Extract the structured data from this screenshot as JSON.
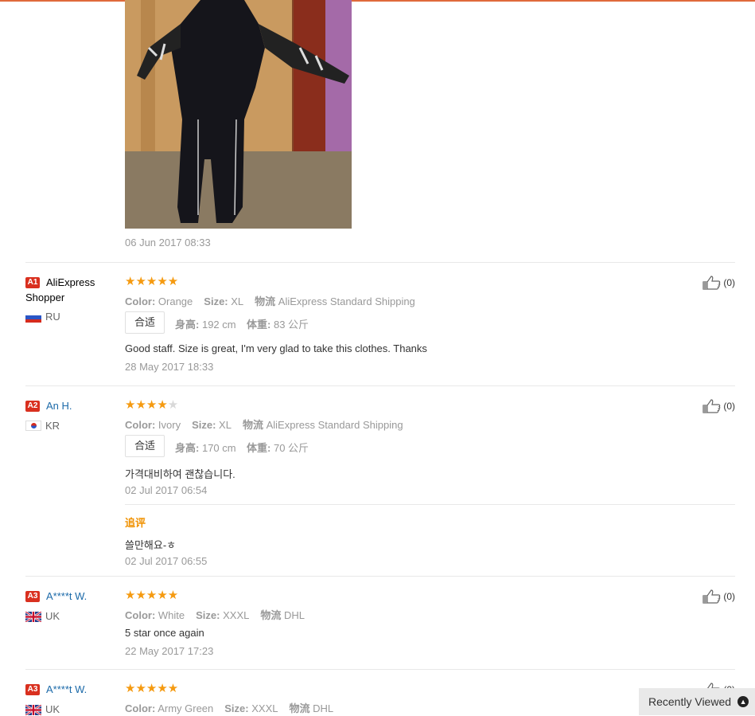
{
  "first_review": {
    "date": "06 Jun 2017 08:33"
  },
  "labels": {
    "color": "Color:",
    "size": "Size:",
    "shipping": "物流",
    "height": "身高:",
    "weight": "体重:"
  },
  "reviews": [
    {
      "rank": "A1",
      "name": "AliExpress Shopper",
      "country": "RU",
      "stars": "★★★★★",
      "stars_off": "",
      "color": "Orange",
      "size": "XL",
      "shipping": "AliExpress Standard Shipping",
      "fit": "合适",
      "height": "192 cm",
      "weight": "83 公斤",
      "text": "Good staff. Size is great, I'm very glad to take this clothes. Thanks",
      "date": "28 May 2017 18:33",
      "likes": "(0)"
    },
    {
      "rank": "A2",
      "name": "An H.",
      "country": "KR",
      "stars": "★★★★",
      "stars_off": "★",
      "color": "Ivory",
      "size": "XL",
      "shipping": "AliExpress Standard Shipping",
      "fit": "合适",
      "height": "170 cm",
      "weight": "70 公斤",
      "text": "가격대비하여 괜찮습니다.",
      "date": "02 Jul 2017 06:54",
      "followup_label": "追评",
      "followup_text": "쓸만해요-ㅎ",
      "followup_date": "02 Jul 2017 06:55",
      "likes": "(0)"
    },
    {
      "rank": "A3",
      "name": "A****t W.",
      "country": "UK",
      "stars": "★★★★★",
      "stars_off": "",
      "color": "White",
      "size": "XXXL",
      "shipping": "DHL",
      "text": "5 star once again",
      "date": "22 May 2017 17:23",
      "likes": "(0)"
    },
    {
      "rank": "A3",
      "name": "A****t W.",
      "country": "UK",
      "stars": "★★★★★",
      "stars_off": "",
      "color": "Army Green",
      "size": "XXXL",
      "shipping": "DHL",
      "likes": "(0)"
    }
  ],
  "recently_viewed": {
    "label": "Recently Viewed",
    "icon": "chevron-up-icon"
  },
  "colors": {
    "star": "#f59a10",
    "badge": "#d9301f",
    "link": "#1c6aa9",
    "followup": "#f09100"
  }
}
